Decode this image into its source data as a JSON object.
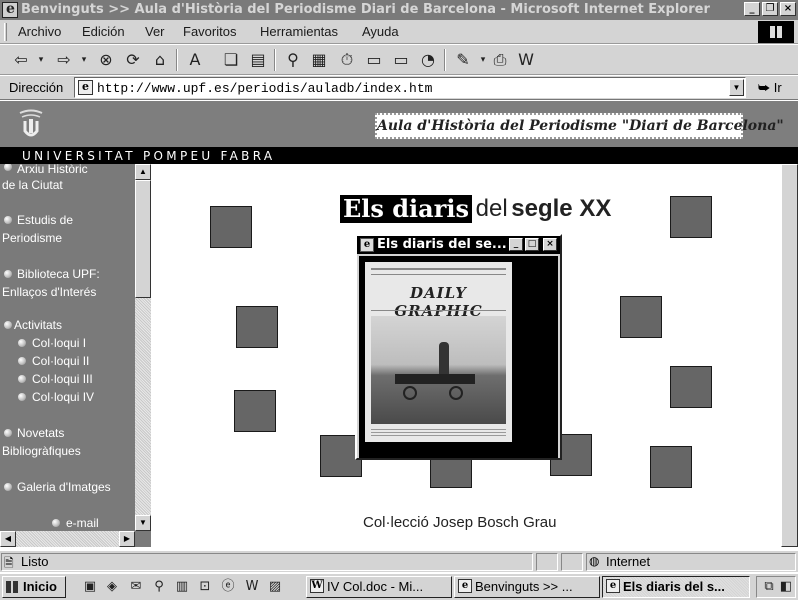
{
  "window": {
    "title": "Benvinguts >> Aula d'Història del Periodisme Diari de Barcelona - Microsoft Internet Explorer",
    "controls": [
      "_",
      "❐",
      "×"
    ]
  },
  "menu": [
    "Archivo",
    "Edición",
    "Ver",
    "Favoritos",
    "Herramientas",
    "Ayuda"
  ],
  "toolbar": {
    "icons": [
      "back-icon",
      "forward-icon",
      "stop-icon",
      "refresh-icon",
      "home-icon",
      "font-size-icon",
      "copy-icon",
      "paste-icon",
      "search-icon",
      "favorites-icon",
      "history-icon",
      "folder-icon",
      "folder-up-icon",
      "media-icon",
      "edit-icon",
      "print-icon",
      "word-icon"
    ]
  },
  "address": {
    "label": "Dirección",
    "url": "http://www.upf.es/periodis/auladb/index.htm",
    "go": "Ir"
  },
  "header": {
    "site_title": "Aula d'Història del Periodisme \"Diari de Barcelona\"",
    "university": "UNIVERSITAT POMPEU FABRA"
  },
  "sidebar": {
    "items": [
      {
        "line1": "Arxiu Històric",
        "line2": "de la Ciutat"
      },
      {
        "line1": "Estudis de",
        "line2": "Periodisme"
      },
      {
        "line1": "Biblioteca UPF:",
        "line2": "Enllaços d'Interés"
      },
      {
        "line1": "Activitats",
        "line2": ""
      },
      {
        "line1": "Novetats",
        "line2": "Bibliogràfiques"
      },
      {
        "line1": "Galeria d'Imatges",
        "line2": ""
      }
    ],
    "subitems": [
      "Col·loqui I",
      "Col·loqui II",
      "Col·loqui III",
      "Col·loqui IV"
    ],
    "email": "e-mail"
  },
  "main": {
    "headline_part1": "Els diaris",
    "headline_part2": "del",
    "headline_part3": "segle XX",
    "caption": "Col·lecció Josep Bosch Grau"
  },
  "popup": {
    "title": "Els diaris del se...",
    "masthead": "DAILY GRAPHIC",
    "controls": [
      "_",
      "□",
      "×"
    ]
  },
  "status": {
    "text": "Listo",
    "zone": "Internet"
  },
  "taskbar": {
    "start": "Inicio",
    "tasks": [
      "IV Col.doc - Mi...",
      "Benvinguts >> ...",
      "Els diaris del s..."
    ]
  }
}
